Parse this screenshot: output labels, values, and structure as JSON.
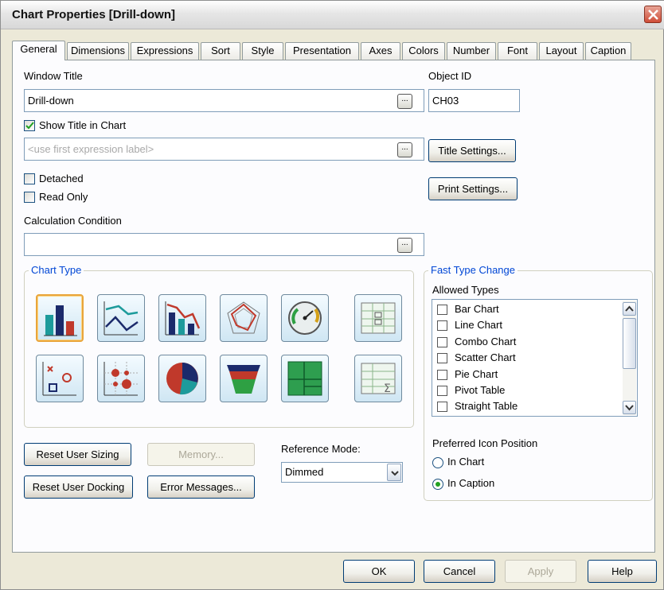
{
  "window": {
    "title": "Chart Properties [Drill-down]"
  },
  "tabs": [
    {
      "label": "General"
    },
    {
      "label": "Dimensions"
    },
    {
      "label": "Expressions"
    },
    {
      "label": "Sort"
    },
    {
      "label": "Style"
    },
    {
      "label": "Presentation"
    },
    {
      "label": "Axes"
    },
    {
      "label": "Colors"
    },
    {
      "label": "Number"
    },
    {
      "label": "Font"
    },
    {
      "label": "Layout"
    },
    {
      "label": "Caption"
    }
  ],
  "general": {
    "window_title_label": "Window Title",
    "window_title_value": "Drill-down",
    "object_id_label": "Object ID",
    "object_id_value": "CH03",
    "show_title_label": "Show Title in Chart",
    "show_title_checked": true,
    "title_placeholder": "<use first expression label>",
    "title_settings_button": "Title Settings...",
    "detached_label": "Detached",
    "read_only_label": "Read Only",
    "print_settings_button": "Print Settings...",
    "calc_condition_label": "Calculation Condition",
    "calc_condition_value": "",
    "ellipsis": "..."
  },
  "chart_type": {
    "legend": "Chart Type",
    "selected": "bar-chart"
  },
  "fast_type_change": {
    "legend": "Fast Type Change",
    "allowed_types_label": "Allowed Types",
    "types": [
      {
        "label": "Bar Chart",
        "checked": false
      },
      {
        "label": "Line Chart",
        "checked": false
      },
      {
        "label": "Combo Chart",
        "checked": false
      },
      {
        "label": "Scatter Chart",
        "checked": false
      },
      {
        "label": "Pie Chart",
        "checked": false
      },
      {
        "label": "Pivot Table",
        "checked": false
      },
      {
        "label": "Straight Table",
        "checked": false
      }
    ],
    "preferred_icon_label": "Preferred Icon Position",
    "in_chart_label": "In Chart",
    "in_caption_label": "In Caption",
    "selected_position": "In Caption"
  },
  "buttons": {
    "reset_user_sizing": "Reset User Sizing",
    "memory": "Memory...",
    "reset_user_docking": "Reset User Docking",
    "error_messages": "Error Messages...",
    "reference_mode_label": "Reference Mode:",
    "reference_mode_value": "Dimmed"
  },
  "footer": {
    "ok": "OK",
    "cancel": "Cancel",
    "apply": "Apply",
    "help": "Help"
  },
  "colors": {
    "accent_group": "#0046d5",
    "selected_icon_border": "#e9a53b",
    "radio_dot": "#21a121"
  }
}
